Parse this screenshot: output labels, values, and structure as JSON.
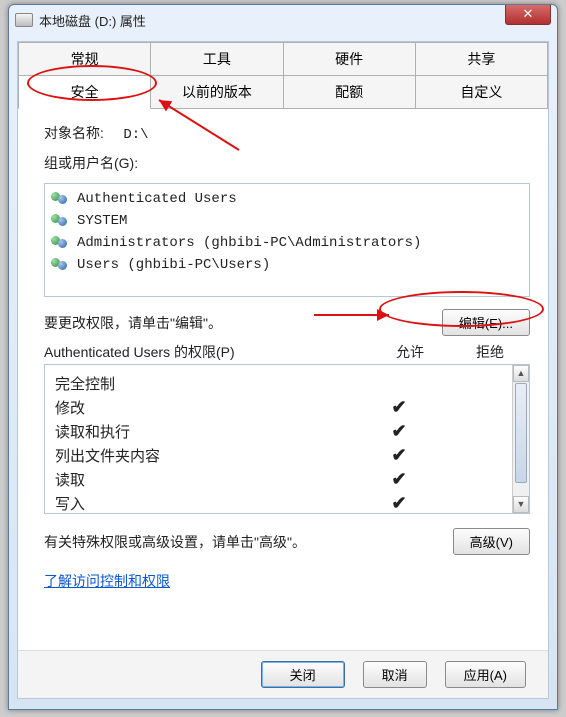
{
  "window": {
    "title": "本地磁盘 (D:) 属性",
    "close_glyph": "✕"
  },
  "tabs": {
    "row1": [
      "常规",
      "工具",
      "硬件",
      "共享"
    ],
    "row2": [
      "安全",
      "以前的版本",
      "配额",
      "自定义"
    ],
    "active": "安全"
  },
  "object": {
    "label": "对象名称:",
    "value": "D:\\"
  },
  "groups": {
    "label": "组或用户名(G):",
    "items": [
      "Authenticated Users",
      "SYSTEM",
      "Administrators (ghbibi-PC\\Administrators)",
      "Users (ghbibi-PC\\Users)"
    ]
  },
  "edit": {
    "text": "要更改权限，请单击\"编辑\"。",
    "button": "编辑(E)..."
  },
  "perm": {
    "header": "Authenticated Users 的权限(P)",
    "allow": "允许",
    "deny": "拒绝",
    "rows": [
      {
        "name": "完全控制",
        "allow": false,
        "deny": false
      },
      {
        "name": "修改",
        "allow": true,
        "deny": false
      },
      {
        "name": "读取和执行",
        "allow": true,
        "deny": false
      },
      {
        "name": "列出文件夹内容",
        "allow": true,
        "deny": false
      },
      {
        "name": "读取",
        "allow": true,
        "deny": false
      },
      {
        "name": "写入",
        "allow": true,
        "deny": false
      }
    ]
  },
  "advanced": {
    "text": "有关特殊权限或高级设置，请单击\"高级\"。",
    "button": "高级(V)"
  },
  "link": "了解访问控制和权限",
  "footer": {
    "close": "关闭",
    "cancel": "取消",
    "apply": "应用(A)"
  }
}
